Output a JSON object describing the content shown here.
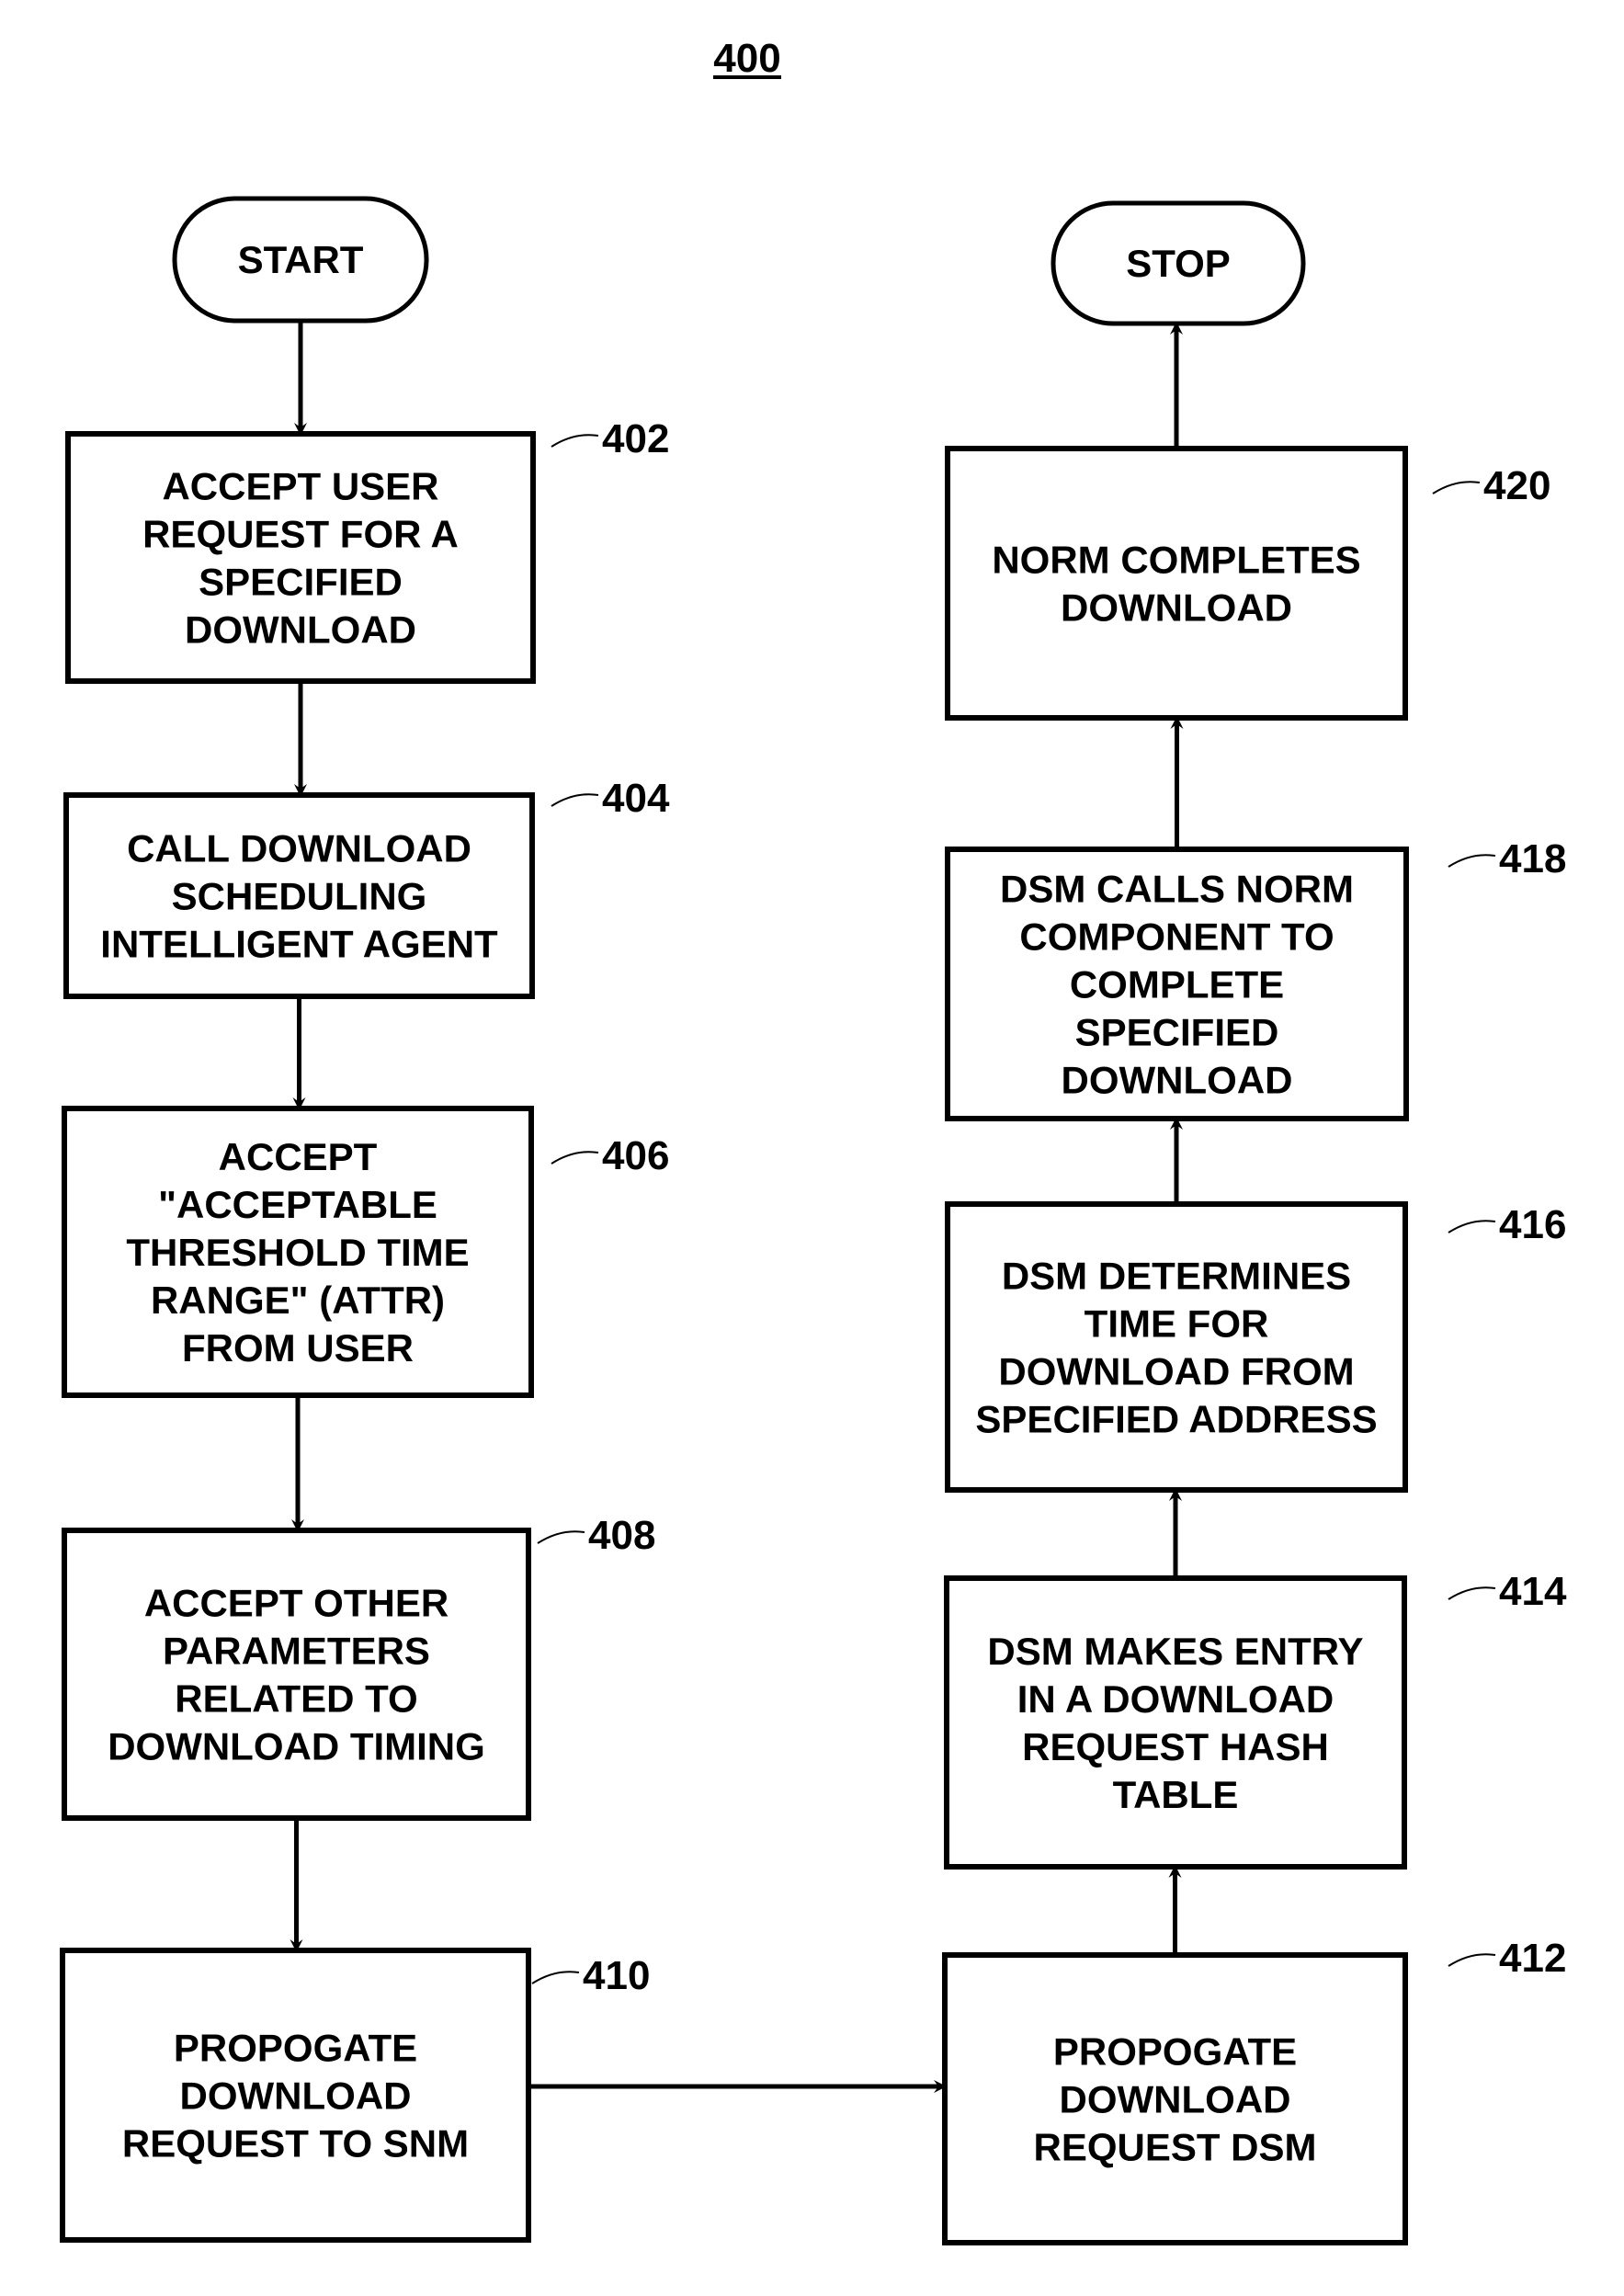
{
  "figure": {
    "number": "400",
    "terminals": {
      "start": {
        "label": "START"
      },
      "stop": {
        "label": "STOP"
      }
    },
    "steps": [
      {
        "id": "402",
        "lines": [
          "ACCEPT USER",
          "REQUEST FOR A",
          "SPECIFIED",
          "DOWNLOAD"
        ]
      },
      {
        "id": "404",
        "lines": [
          "CALL DOWNLOAD",
          "SCHEDULING",
          "INTELLIGENT AGENT"
        ]
      },
      {
        "id": "406",
        "lines": [
          "ACCEPT",
          "\"ACCEPTABLE",
          "THRESHOLD TIME",
          "RANGE\" (ATTR)",
          "FROM USER"
        ]
      },
      {
        "id": "408",
        "lines": [
          "ACCEPT OTHER",
          "PARAMETERS",
          "RELATED TO",
          "DOWNLOAD TIMING"
        ]
      },
      {
        "id": "410",
        "lines": [
          "PROPOGATE",
          "DOWNLOAD",
          "REQUEST TO SNM"
        ]
      },
      {
        "id": "412",
        "lines": [
          "PROPOGATE",
          "DOWNLOAD",
          "REQUEST  DSM"
        ]
      },
      {
        "id": "414",
        "lines": [
          "DSM MAKES ENTRY",
          "IN A DOWNLOAD",
          "REQUEST HASH",
          "TABLE"
        ]
      },
      {
        "id": "416",
        "lines": [
          "DSM DETERMINES",
          "TIME FOR",
          "DOWNLOAD FROM",
          "SPECIFIED ADDRESS"
        ]
      },
      {
        "id": "418",
        "lines": [
          "DSM CALLS NORM",
          "COMPONENT TO",
          "COMPLETE",
          "SPECIFIED",
          "DOWNLOAD"
        ]
      },
      {
        "id": "420",
        "lines": [
          "NORM COMPLETES",
          "DOWNLOAD"
        ]
      }
    ],
    "flow": [
      [
        "start",
        "402"
      ],
      [
        "402",
        "404"
      ],
      [
        "404",
        "406"
      ],
      [
        "406",
        "408"
      ],
      [
        "408",
        "410"
      ],
      [
        "410",
        "412"
      ],
      [
        "412",
        "414"
      ],
      [
        "414",
        "416"
      ],
      [
        "416",
        "418"
      ],
      [
        "418",
        "420"
      ],
      [
        "420",
        "stop"
      ]
    ]
  }
}
